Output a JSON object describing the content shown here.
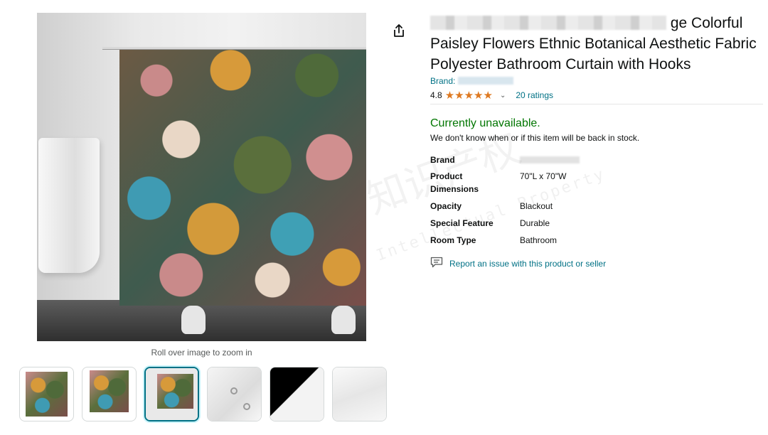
{
  "product": {
    "title_visible": "ge Colorful Paisley Flowers Ethnic Botanical Aesthetic Fabric Polyester Bathroom Curtain with Hooks",
    "brand_label": "Brand:",
    "rating_value": "4.8",
    "stars": "★★★★★",
    "ratings_link": "20 ratings"
  },
  "availability": {
    "status": "Currently unavailable.",
    "note": "We don't know when or if this item will be back in stock."
  },
  "specs": [
    {
      "label": "Brand",
      "value": ""
    },
    {
      "label": "Product Dimensions",
      "value": "70\"L x 70\"W"
    },
    {
      "label": "Opacity",
      "value": "Blackout"
    },
    {
      "label": "Special Feature",
      "value": "Durable"
    },
    {
      "label": "Room Type",
      "value": "Bathroom"
    }
  ],
  "report_link": "Report an issue with this product or seller",
  "image": {
    "zoom_hint": "Roll over image to zoom in"
  },
  "watermark": {
    "cn": "知识产权",
    "en": "Intellectual Property"
  },
  "icons": {
    "share": "share-icon",
    "report": "report-icon",
    "chevron": "chevron-down-icon"
  },
  "colors": {
    "link": "#007185",
    "available_green": "#007600",
    "star": "#de7921",
    "thumb_active": "#007185"
  }
}
